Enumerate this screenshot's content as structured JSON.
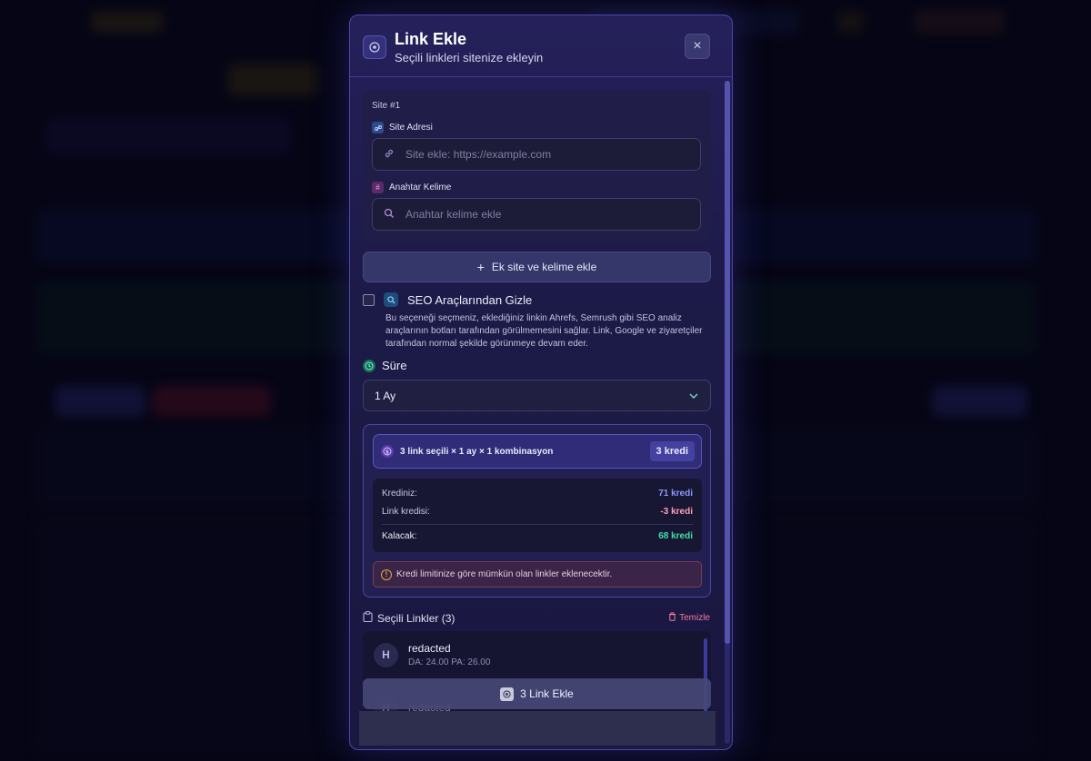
{
  "modal": {
    "title": "Link Ekle",
    "subtitle": "Seçili linkleri sitenize ekleyin",
    "close_icon": "×"
  },
  "site": {
    "label": "Site #1",
    "address_label": "Site Adresi",
    "address_placeholder": "Site ekle: https://example.com",
    "keyword_label": "Anahtar Kelime",
    "keyword_icon": "#",
    "keyword_placeholder": "Anahtar kelime ekle"
  },
  "add_site_button": {
    "icon": "+",
    "label": "Ek site ve kelime ekle"
  },
  "seo": {
    "title": "SEO Araçlarından Gizle",
    "description": "Bu seçeneği seçmeniz, eklediğiniz linkin Ahrefs, Semrush gibi SEO analiz araçlarının botları tarafından görülmemesini sağlar. Link, Google ve ziyaretçiler tarafından normal şekilde görünmeye devam eder.",
    "checked": false
  },
  "duration": {
    "label": "Süre",
    "selected": "1 Ay"
  },
  "credit": {
    "combination_text": "3 link seçili × 1 ay × 1 kombinasyon",
    "combination_badge": "3 kredi",
    "rows": [
      {
        "label": "Krediniz:",
        "value": "71 kredi",
        "color": "#8f95ff"
      },
      {
        "label": "Link kredisi:",
        "value": "-3 kredi",
        "color": "#ff9db3"
      },
      {
        "label": "Kalacak:",
        "value": "68 kredi",
        "color": "#3fe0a8"
      }
    ],
    "warning": "Kredi limitinize göre mümkün olan linkler eklenecektir."
  },
  "selected_links": {
    "header": "Seçili Linkler (3)",
    "clear_label": "Temizle",
    "items": [
      {
        "avatar": "H",
        "name": "redacted",
        "meta": "DA: 24.00   PA: 26.00"
      },
      {
        "avatar": "H",
        "name": "redacted",
        "meta": ""
      }
    ]
  },
  "submit_button": {
    "label": "3 Link Ekle"
  },
  "colors": {
    "accent": "#4b48a8",
    "modal_bg": "#201e4e",
    "positive": "#3fe0a8",
    "negative": "#ff9db3"
  }
}
